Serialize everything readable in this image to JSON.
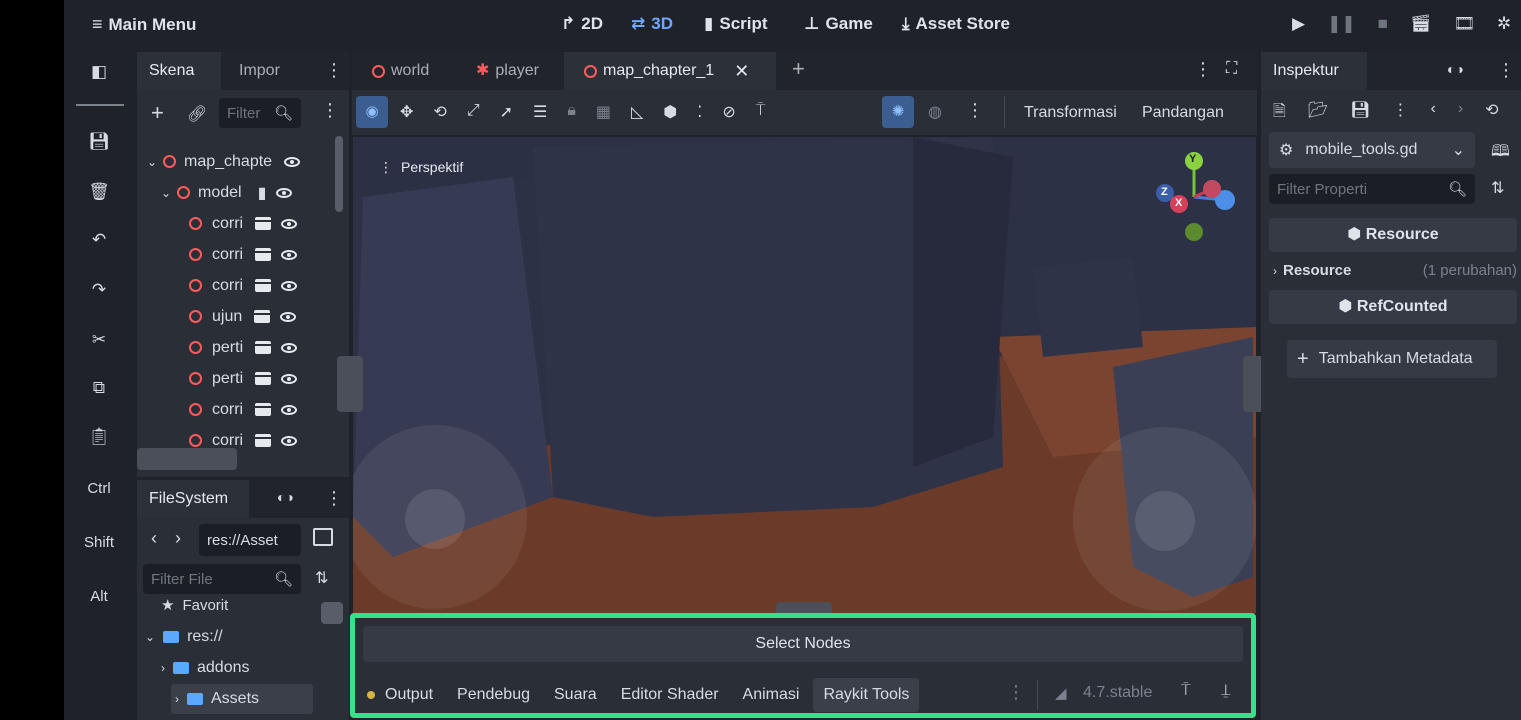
{
  "topbar": {
    "main_menu": "Main Menu",
    "views": [
      {
        "label": "2D",
        "icon": "2d-icon"
      },
      {
        "label": "3D",
        "icon": "3d-icon"
      },
      {
        "label": "Script",
        "icon": "script-icon"
      },
      {
        "label": "Game",
        "icon": "game-icon"
      },
      {
        "label": "Asset Store",
        "icon": "asset-store-icon"
      }
    ],
    "active_view": "3D"
  },
  "left_rail": {
    "keys": [
      "Ctrl",
      "Shift",
      "Alt"
    ]
  },
  "scene_panel": {
    "tabs": [
      "Skena",
      "Impor"
    ],
    "filter_placeholder": "Filter",
    "tree": [
      {
        "name": "map_chapte",
        "level": 0
      },
      {
        "name": "model",
        "level": 1
      },
      {
        "name": "corri",
        "level": 2
      },
      {
        "name": "corri",
        "level": 2
      },
      {
        "name": "corri",
        "level": 2
      },
      {
        "name": "ujun",
        "level": 2
      },
      {
        "name": "perti",
        "level": 2
      },
      {
        "name": "perti",
        "level": 2
      },
      {
        "name": "corri",
        "level": 2
      },
      {
        "name": "corri",
        "level": 2
      }
    ]
  },
  "filesystem": {
    "title": "FileSystem",
    "path": "res://Asset",
    "filter_placeholder": "Filter File",
    "favorites": "Favorit",
    "items": [
      "res://",
      "addons",
      "Assets"
    ]
  },
  "editor_tabs": {
    "tabs": [
      "world",
      "player",
      "map_chapter_1"
    ],
    "active": "map_chapter_1"
  },
  "viewport_toolbar": {
    "transform_label": "Transformasi",
    "view_label": "Pandangan"
  },
  "viewport": {
    "perspective_label": "Perspektif",
    "gizmo_axes": {
      "y": "Y",
      "x": "X",
      "z": "Z"
    }
  },
  "bottom_panel": {
    "select_nodes": "Select Nodes",
    "tabs": [
      "Output",
      "Pendebug",
      "Suara",
      "Editor Shader",
      "Animasi",
      "Raykit Tools"
    ],
    "active_tab": "Raykit Tools",
    "version": "4.7.stable"
  },
  "inspector": {
    "title": "Inspektur",
    "resource_file": "mobile_tools.gd",
    "filter_placeholder": "Filter Properti",
    "resource_button": "Resource",
    "resource_section": "Resource",
    "resource_changes": "(1 perubahan)",
    "refcounted_button": "RefCounted",
    "add_metadata": "Tambahkan Metadata"
  },
  "colors": {
    "accent": "#6ea8ff",
    "node_circle": "#ff5b5b",
    "highlight_border": "#37e08a"
  }
}
